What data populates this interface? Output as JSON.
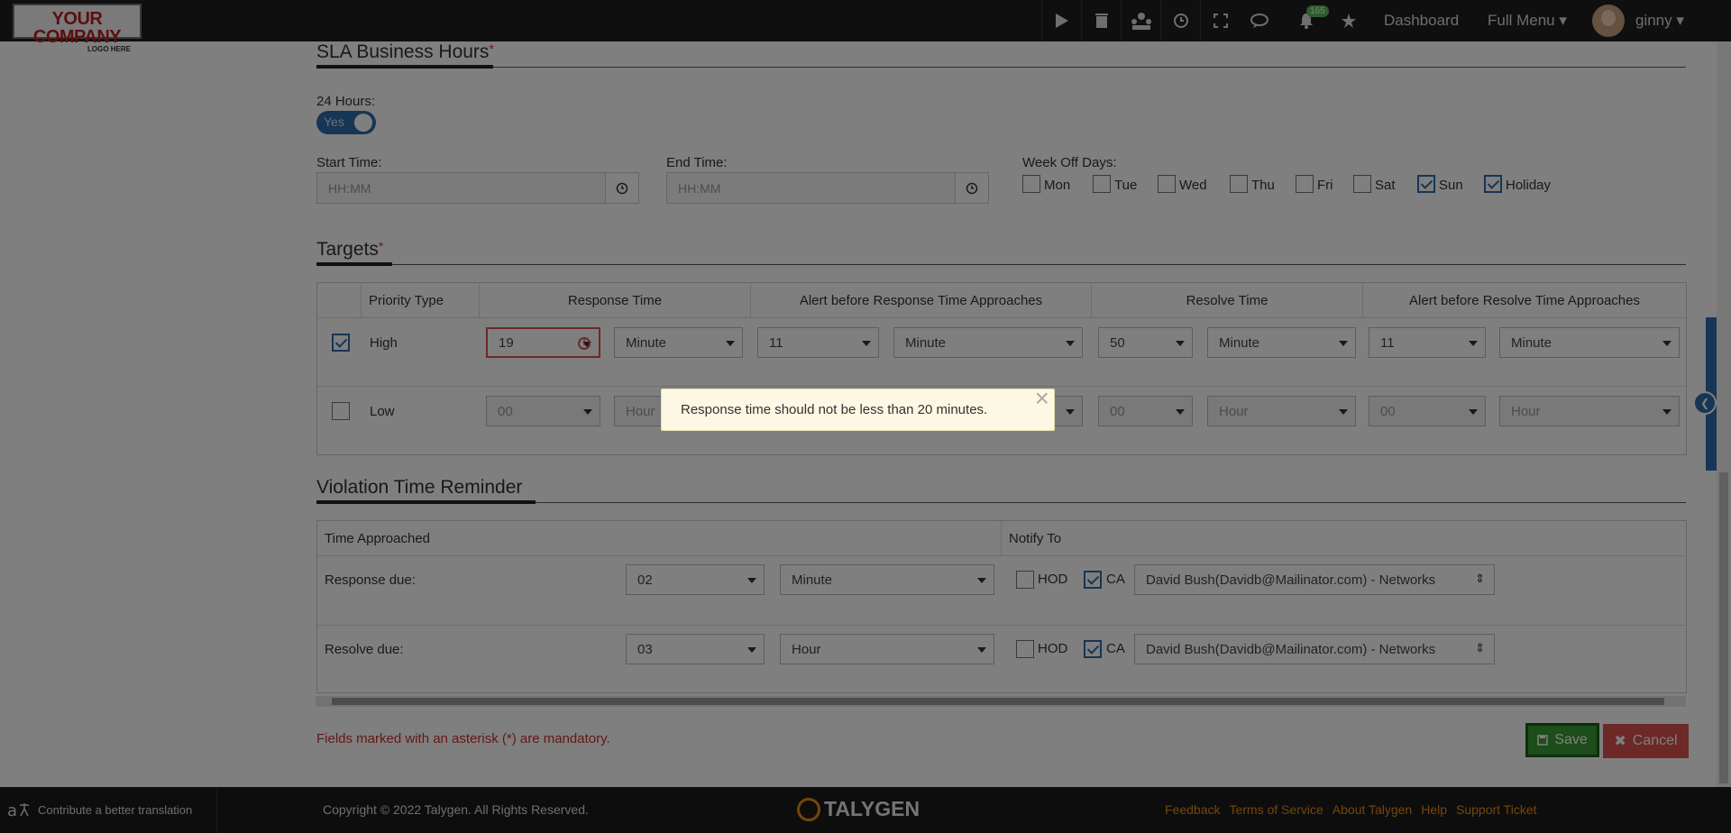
{
  "header": {
    "logo_line1": "YOUR COMPANY",
    "logo_line2": "LOGO HERE",
    "notification_count": "165",
    "dashboard": "Dashboard",
    "full_menu": "Full Menu",
    "user": "ginny"
  },
  "sla": {
    "title": "SLA Business Hours",
    "required_mark": "*",
    "hours24_label": "24 Hours:",
    "hours24_value": "Yes",
    "start_label": "Start Time:",
    "start_placeholder": "HH:MM",
    "end_label": "End Time:",
    "end_placeholder": "HH:MM",
    "weekoff_label": "Week Off Days:",
    "days": [
      {
        "label": "Mon",
        "checked": false
      },
      {
        "label": "Tue",
        "checked": false
      },
      {
        "label": "Wed",
        "checked": false
      },
      {
        "label": "Thu",
        "checked": false
      },
      {
        "label": "Fri",
        "checked": false
      },
      {
        "label": "Sat",
        "checked": false
      },
      {
        "label": "Sun",
        "checked": true
      },
      {
        "label": "Holiday",
        "checked": true
      }
    ]
  },
  "targets": {
    "title": "Targets",
    "required_mark": "*",
    "columns": [
      "Priority Type",
      "Response Time",
      "Alert before Response Time Approaches",
      "Resolve Time",
      "Alert before Resolve Time Approaches"
    ],
    "rows": [
      {
        "checked": true,
        "priority": "High",
        "response_value": "19",
        "response_unit": "Minute",
        "alert_resp_value": "11",
        "alert_resp_unit": "Minute",
        "resolve_value": "50",
        "resolve_unit": "Minute",
        "alert_res_value": "11",
        "alert_res_unit": "Minute"
      },
      {
        "checked": false,
        "priority": "Low",
        "response_value": "00",
        "response_unit": "Hour",
        "resolve_value": "00",
        "resolve_unit": "Hour",
        "alert_res_value": "00",
        "alert_res_unit": "Hour"
      }
    ]
  },
  "violation": {
    "title": "Violation Time Reminder",
    "col_time": "Time Approached",
    "col_notify": "Notify To",
    "rows": [
      {
        "label": "Response due:",
        "value": "02",
        "unit": "Minute",
        "hod": "HOD",
        "hod_checked": false,
        "ca": "CA",
        "ca_checked": true,
        "person": "David Bush(Davidb@Mailinator.com) - Networks"
      },
      {
        "label": "Resolve due:",
        "value": "03",
        "unit": "Hour",
        "hod": "HOD",
        "hod_checked": false,
        "ca": "CA",
        "ca_checked": true,
        "person": "David Bush(Davidb@Mailinator.com) - Networks"
      }
    ]
  },
  "form": {
    "mandatory_note": "Fields marked with an asterisk (*) are mandatory.",
    "save": "Save",
    "cancel": "Cancel"
  },
  "footer": {
    "contribute": "Contribute a better translation",
    "copyright": "Copyright © 2022 Talygen. All Rights Reserved.",
    "brand": "TALYGEN",
    "links": [
      "Feedback",
      "Terms of Service",
      "About Talygen",
      "Help",
      "Support Ticket"
    ]
  },
  "modal": {
    "message": "Response time should not be less than 20 minutes.",
    "close": "×"
  }
}
